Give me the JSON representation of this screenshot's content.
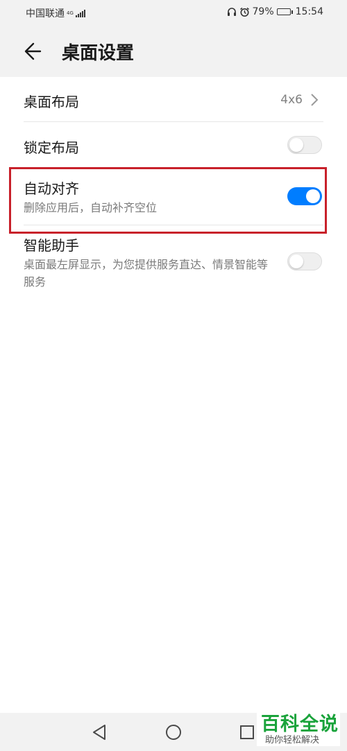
{
  "status_bar": {
    "carrier": "中国联通",
    "network_type": "4G",
    "battery_percent": "79%",
    "battery_level": 0.79,
    "time": "15:54",
    "icons": [
      "headset-icon",
      "alarm-icon",
      "battery-icon",
      "signal-icon"
    ]
  },
  "header": {
    "title": "桌面设置",
    "back_icon": "arrow-left-icon"
  },
  "settings": {
    "layout": {
      "label": "桌面布局",
      "value": "4x6"
    },
    "lock_layout": {
      "label": "锁定布局",
      "enabled": false
    },
    "auto_align": {
      "label": "自动对齐",
      "description": "删除应用后，自动补齐空位",
      "enabled": true
    },
    "smart_assistant": {
      "label": "智能助手",
      "description": "桌面最左屏显示，为您提供服务直达、情景智能等服务",
      "enabled": false
    }
  },
  "navbar": {
    "icons": [
      "nav-back-icon",
      "nav-home-icon",
      "nav-recent-icon"
    ]
  },
  "watermark": {
    "title": "百科全说",
    "subtitle": "助你轻松解决"
  },
  "colors": {
    "accent": "#007dff",
    "highlight_border": "#c8202a",
    "watermark_green": "#1aa33b"
  }
}
